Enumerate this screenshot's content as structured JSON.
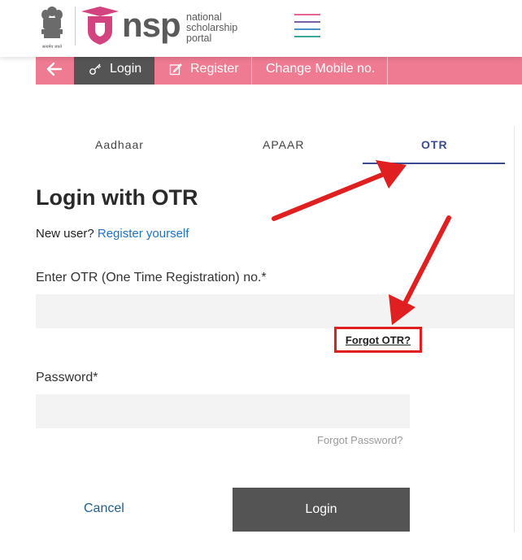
{
  "header": {
    "emblem_caption": "सत्यमेव जयते",
    "logo_word": "NSP",
    "logo_sub": [
      "national",
      "scholarship",
      "portal"
    ],
    "hamburger_colors": [
      "#e46494",
      "#7b60a8",
      "#4e8fc4",
      "#3aa99c"
    ]
  },
  "nav": {
    "back_icon": "arrow-left-icon",
    "login": "Login",
    "register": "Register",
    "change_mobile": "Change Mobile no."
  },
  "tabs": {
    "aadhaar": "Aadhaar",
    "apaar": "APAAR",
    "otr": "OTR",
    "active": "OTR"
  },
  "form": {
    "title": "Login with OTR",
    "new_user": "New user?",
    "register_link": "Register yourself",
    "otr_label": "Enter OTR (One Time Registration) no.*",
    "otr_value": "",
    "forgot_otr": "Forgot OTR?",
    "password_label": "Password*",
    "password_value": "",
    "forgot_password": "Forgot Password?",
    "cancel": "Cancel",
    "login": "Login"
  },
  "colors": {
    "navbar": "#ef7b92",
    "active_nav": "#555455",
    "tab_active": "#3a4c8f",
    "link": "#1f73c7",
    "annotation": "#e02020"
  }
}
